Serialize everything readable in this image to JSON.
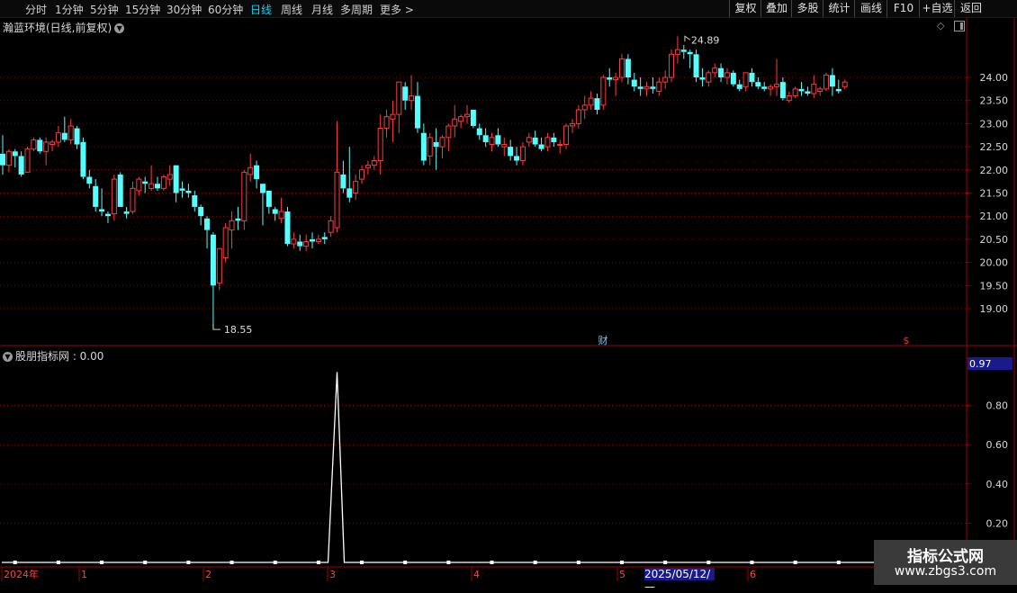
{
  "toolbar": {
    "periods": [
      "分时",
      "1分钟",
      "5分钟",
      "15分钟",
      "30分钟",
      "60分钟",
      "日线",
      "周线",
      "月线",
      "多周期",
      "更多 >"
    ],
    "active_period": "日线",
    "right_buttons": [
      "复权",
      "叠加",
      "多股",
      "统计",
      "画线",
      "F10",
      "+自选",
      "返回"
    ]
  },
  "main_chart": {
    "title": "瀚蓝环境(日线,前复权)",
    "title_icon": "chevron-down-icon",
    "corner_icons": [
      "diamond-icon",
      "window-icon"
    ],
    "high_label": "24.89",
    "low_label": "18.55",
    "events": [
      {
        "label": "财",
        "color": "#5ad2ff"
      },
      {
        "label": "$",
        "color": "#ff3030"
      }
    ],
    "y_ticks": [
      "24.00",
      "23.50",
      "23.00",
      "22.50",
      "22.00",
      "21.50",
      "21.00",
      "20.50",
      "20.00",
      "19.50",
      "19.00"
    ],
    "y_range": [
      18.55,
      24.89
    ],
    "colors": {
      "up": "#ff3c3c",
      "down": "#54ffff",
      "grid": "#8b0000"
    },
    "candles": [
      [
        22.35,
        22.75,
        21.9,
        22.1
      ],
      [
        22.1,
        22.45,
        21.95,
        22.4
      ],
      [
        22.4,
        22.45,
        22.05,
        22.3
      ],
      [
        22.3,
        22.4,
        21.85,
        21.9
      ],
      [
        21.95,
        22.5,
        21.95,
        22.45
      ],
      [
        22.45,
        22.7,
        22.4,
        22.65
      ],
      [
        22.65,
        22.7,
        22.35,
        22.4
      ],
      [
        22.4,
        22.7,
        22.1,
        22.6
      ],
      [
        22.55,
        22.65,
        22.4,
        22.6
      ],
      [
        22.6,
        22.95,
        22.5,
        22.8
      ],
      [
        22.8,
        23.15,
        22.6,
        22.65
      ],
      [
        22.65,
        23.1,
        22.55,
        22.95
      ],
      [
        22.9,
        22.95,
        22.45,
        22.55
      ],
      [
        22.6,
        22.7,
        21.8,
        21.85
      ],
      [
        21.85,
        22.0,
        21.6,
        21.7
      ],
      [
        21.65,
        21.8,
        21.1,
        21.2
      ],
      [
        21.15,
        21.6,
        21.0,
        21.1
      ],
      [
        21.05,
        21.1,
        20.85,
        21.0
      ],
      [
        21.05,
        21.9,
        20.9,
        21.8
      ],
      [
        21.9,
        21.95,
        21.2,
        21.2
      ],
      [
        21.1,
        21.2,
        20.95,
        21.05
      ],
      [
        21.1,
        21.75,
        21.05,
        21.6
      ],
      [
        21.55,
        21.85,
        21.45,
        21.8
      ],
      [
        21.75,
        21.85,
        21.5,
        21.7
      ],
      [
        21.6,
        22.1,
        21.55,
        21.7
      ],
      [
        21.7,
        21.85,
        21.55,
        21.6
      ],
      [
        21.6,
        21.9,
        21.55,
        21.85
      ],
      [
        21.8,
        22.1,
        21.65,
        21.9
      ],
      [
        22.1,
        22.1,
        21.3,
        21.5
      ],
      [
        21.6,
        21.75,
        21.4,
        21.55
      ],
      [
        21.55,
        21.7,
        21.4,
        21.5
      ],
      [
        21.45,
        21.55,
        21.1,
        21.2
      ],
      [
        21.2,
        21.25,
        20.8,
        21.0
      ],
      [
        20.95,
        21.0,
        20.3,
        20.7
      ],
      [
        20.6,
        20.65,
        18.55,
        19.5
      ],
      [
        19.55,
        20.3,
        19.4,
        20.3
      ],
      [
        20.1,
        20.85,
        20.0,
        20.75
      ],
      [
        20.7,
        21.1,
        20.3,
        20.9
      ],
      [
        20.95,
        21.2,
        20.7,
        20.9
      ],
      [
        20.9,
        22.0,
        20.7,
        21.95
      ],
      [
        21.9,
        22.35,
        21.75,
        22.05
      ],
      [
        22.1,
        22.2,
        21.6,
        21.8
      ],
      [
        21.7,
        21.7,
        20.8,
        21.5
      ],
      [
        21.55,
        21.55,
        21.05,
        21.2
      ],
      [
        21.15,
        21.2,
        20.9,
        21.05
      ],
      [
        20.95,
        21.4,
        20.85,
        21.1
      ],
      [
        21.1,
        21.2,
        20.35,
        20.4
      ],
      [
        20.4,
        20.65,
        20.3,
        20.5
      ],
      [
        20.45,
        20.6,
        20.25,
        20.35
      ],
      [
        20.35,
        20.6,
        20.25,
        20.45
      ],
      [
        20.5,
        20.65,
        20.3,
        20.45
      ],
      [
        20.45,
        20.6,
        20.4,
        20.5
      ],
      [
        20.55,
        20.65,
        20.4,
        20.5
      ],
      [
        20.65,
        21.0,
        20.55,
        20.9
      ],
      [
        20.75,
        23.05,
        20.65,
        21.95
      ],
      [
        21.9,
        22.2,
        21.5,
        21.6
      ],
      [
        21.6,
        22.5,
        21.3,
        21.4
      ],
      [
        21.5,
        21.9,
        21.35,
        21.75
      ],
      [
        21.8,
        22.1,
        21.7,
        22.0
      ],
      [
        22.05,
        22.2,
        21.9,
        22.1
      ],
      [
        22.1,
        22.3,
        22.0,
        22.2
      ],
      [
        22.2,
        23.2,
        21.9,
        22.9
      ],
      [
        22.9,
        23.3,
        22.7,
        23.15
      ],
      [
        23.1,
        23.5,
        22.6,
        23.2
      ],
      [
        23.2,
        23.9,
        22.8,
        23.9
      ],
      [
        23.8,
        23.9,
        23.3,
        23.5
      ],
      [
        23.5,
        24.05,
        23.3,
        23.6
      ],
      [
        23.6,
        23.9,
        22.8,
        22.9
      ],
      [
        22.8,
        23.0,
        22.1,
        22.2
      ],
      [
        22.3,
        22.8,
        22.1,
        22.7
      ],
      [
        22.6,
        22.9,
        22.0,
        22.5
      ],
      [
        22.5,
        22.75,
        22.25,
        22.7
      ],
      [
        22.7,
        23.0,
        22.4,
        22.95
      ],
      [
        22.95,
        23.4,
        22.7,
        23.1
      ],
      [
        23.05,
        23.2,
        22.9,
        23.15
      ],
      [
        23.15,
        23.4,
        23.0,
        23.2
      ],
      [
        23.3,
        23.3,
        22.9,
        22.95
      ],
      [
        22.9,
        23.0,
        22.65,
        22.75
      ],
      [
        22.75,
        22.9,
        22.5,
        22.6
      ],
      [
        22.55,
        22.8,
        22.4,
        22.7
      ],
      [
        22.75,
        22.9,
        22.5,
        22.55
      ],
      [
        22.5,
        22.7,
        22.3,
        22.55
      ],
      [
        22.5,
        22.65,
        22.2,
        22.3
      ],
      [
        22.3,
        22.5,
        22.1,
        22.2
      ],
      [
        22.2,
        22.6,
        22.1,
        22.5
      ],
      [
        22.6,
        22.8,
        22.5,
        22.7
      ],
      [
        22.7,
        22.85,
        22.5,
        22.55
      ],
      [
        22.55,
        22.7,
        22.4,
        22.45
      ],
      [
        22.5,
        22.8,
        22.4,
        22.7
      ],
      [
        22.7,
        22.8,
        22.5,
        22.6
      ],
      [
        22.55,
        22.65,
        22.35,
        22.55
      ],
      [
        22.55,
        23.0,
        22.45,
        22.95
      ],
      [
        22.95,
        23.1,
        22.8,
        23.0
      ],
      [
        23.0,
        23.4,
        22.9,
        23.3
      ],
      [
        23.3,
        23.6,
        23.1,
        23.4
      ],
      [
        23.4,
        23.7,
        23.3,
        23.55
      ],
      [
        23.55,
        23.65,
        23.2,
        23.3
      ],
      [
        23.4,
        24.05,
        23.3,
        24.0
      ],
      [
        24.0,
        24.2,
        23.8,
        23.95
      ],
      [
        23.95,
        24.1,
        23.6,
        24.0
      ],
      [
        24.0,
        24.5,
        23.9,
        24.4
      ],
      [
        24.4,
        24.5,
        23.85,
        24.0
      ],
      [
        23.95,
        24.1,
        23.7,
        23.8
      ],
      [
        23.8,
        24.0,
        23.6,
        23.75
      ],
      [
        23.75,
        23.9,
        23.6,
        23.8
      ],
      [
        23.8,
        24.0,
        23.65,
        23.75
      ],
      [
        23.7,
        24.0,
        23.6,
        23.9
      ],
      [
        23.9,
        24.15,
        23.75,
        24.0
      ],
      [
        24.0,
        24.6,
        23.9,
        24.5
      ],
      [
        24.5,
        24.89,
        24.3,
        24.6
      ],
      [
        24.6,
        24.7,
        24.4,
        24.55
      ],
      [
        24.55,
        24.6,
        24.2,
        24.5
      ],
      [
        24.5,
        24.6,
        23.9,
        24.0
      ],
      [
        24.0,
        24.2,
        23.8,
        23.95
      ],
      [
        23.9,
        24.15,
        23.8,
        24.1
      ],
      [
        24.1,
        24.3,
        24.0,
        24.2
      ],
      [
        24.2,
        24.3,
        23.9,
        24.0
      ],
      [
        24.0,
        24.2,
        23.85,
        24.1
      ],
      [
        24.1,
        24.15,
        23.8,
        23.85
      ],
      [
        23.85,
        23.95,
        23.7,
        23.75
      ],
      [
        23.8,
        24.1,
        23.7,
        24.1
      ],
      [
        24.1,
        24.2,
        23.8,
        23.9
      ],
      [
        23.9,
        24.0,
        23.75,
        23.8
      ],
      [
        23.8,
        23.9,
        23.7,
        23.75
      ],
      [
        23.75,
        23.85,
        23.6,
        23.8
      ],
      [
        23.8,
        24.4,
        23.6,
        23.85
      ],
      [
        23.9,
        24.0,
        23.5,
        23.55
      ],
      [
        23.5,
        23.7,
        23.45,
        23.6
      ],
      [
        23.6,
        23.8,
        23.55,
        23.75
      ],
      [
        23.75,
        23.9,
        23.6,
        23.7
      ],
      [
        23.7,
        23.8,
        23.6,
        23.65
      ],
      [
        23.65,
        24.05,
        23.55,
        23.85
      ],
      [
        23.7,
        23.8,
        23.6,
        23.75
      ],
      [
        23.75,
        24.1,
        23.7,
        24.05
      ],
      [
        24.05,
        24.2,
        23.6,
        23.8
      ],
      [
        23.75,
        23.95,
        23.65,
        23.7
      ],
      [
        23.8,
        23.95,
        23.75,
        23.9
      ]
    ]
  },
  "indicator": {
    "title": "股朋指标网 : 0.00",
    "current_value": "0.97",
    "y_ticks": [
      "0.80",
      "0.60",
      "0.40",
      "0.20"
    ],
    "y_range": [
      0,
      1
    ],
    "signal_index": 54,
    "signal_value": 0.97
  },
  "time_axis": {
    "labels": [
      "2024年",
      "1",
      "2",
      "3",
      "4",
      "5",
      "6"
    ],
    "cursor_date": "2025/05/12/—"
  },
  "watermark": {
    "line1": "指标公式网",
    "line2": "www.zbgs3.com"
  }
}
